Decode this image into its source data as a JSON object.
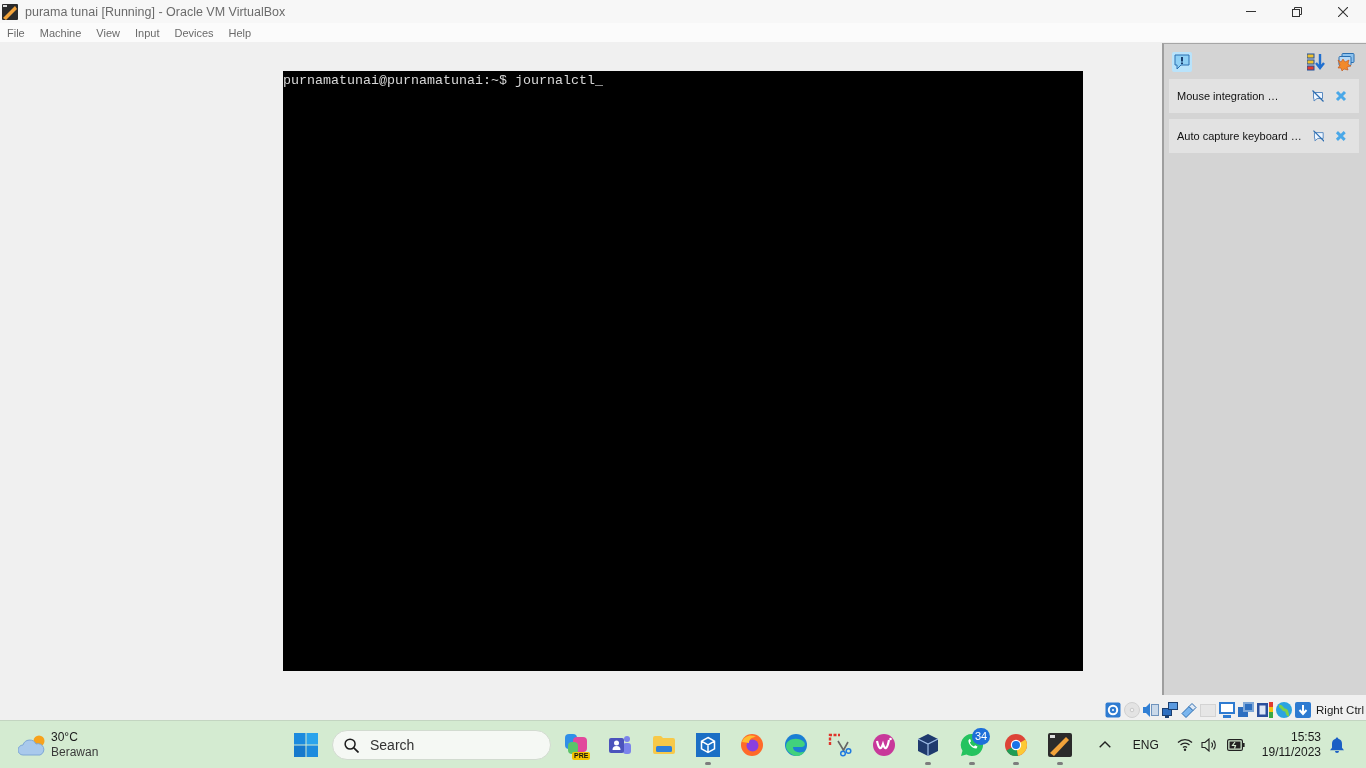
{
  "window": {
    "title": "purama tunai [Running] - Oracle VM VirtualBox"
  },
  "menu_bar": [
    "File",
    "Machine",
    "View",
    "Input",
    "Devices",
    "Help"
  ],
  "vm_screen": {
    "lines": [
      "purnamatunai@purnamatunai:~$ journalctl_"
    ]
  },
  "notification_center": {
    "messages": [
      {
        "text": "Mouse integration …"
      },
      {
        "text": "Auto capture keyboard …"
      }
    ]
  },
  "status_bar": {
    "indicators": [
      {
        "kind": "hard-disk",
        "disabled": false
      },
      {
        "kind": "optical-disk",
        "disabled": true
      },
      {
        "kind": "audio",
        "disabled": false
      },
      {
        "kind": "network",
        "disabled": false
      },
      {
        "kind": "usb",
        "disabled": false
      },
      {
        "kind": "shared-folder",
        "disabled": true
      },
      {
        "kind": "display",
        "disabled": false
      },
      {
        "kind": "recording",
        "disabled": false
      },
      {
        "kind": "cpu",
        "disabled": false
      },
      {
        "kind": "mouse-integration",
        "disabled": false
      },
      {
        "kind": "keyboard-capture",
        "disabled": false
      }
    ],
    "host_key": "Right Ctrl"
  },
  "taskbar": {
    "weather": {
      "temperature": "30°C",
      "condition": "Berawan"
    },
    "search": {
      "placeholder": "Search"
    },
    "apps": [
      {
        "kind": "blob",
        "tag": "PRE",
        "running": false
      },
      {
        "kind": "people",
        "running": false
      },
      {
        "kind": "folder",
        "running": false
      },
      {
        "kind": "cube",
        "running": true
      },
      {
        "kind": "fox",
        "running": false
      },
      {
        "kind": "wave",
        "running": false
      },
      {
        "kind": "snip",
        "running": false
      },
      {
        "kind": "swoosh",
        "running": false
      },
      {
        "kind": "box",
        "running": true
      },
      {
        "kind": "chat",
        "badge": "34",
        "running": true
      },
      {
        "kind": "ring",
        "running": true
      },
      {
        "kind": "vm",
        "running": true
      }
    ],
    "tray": {
      "language": "ENG",
      "time": "15:53",
      "date": "19/11/2023"
    }
  }
}
